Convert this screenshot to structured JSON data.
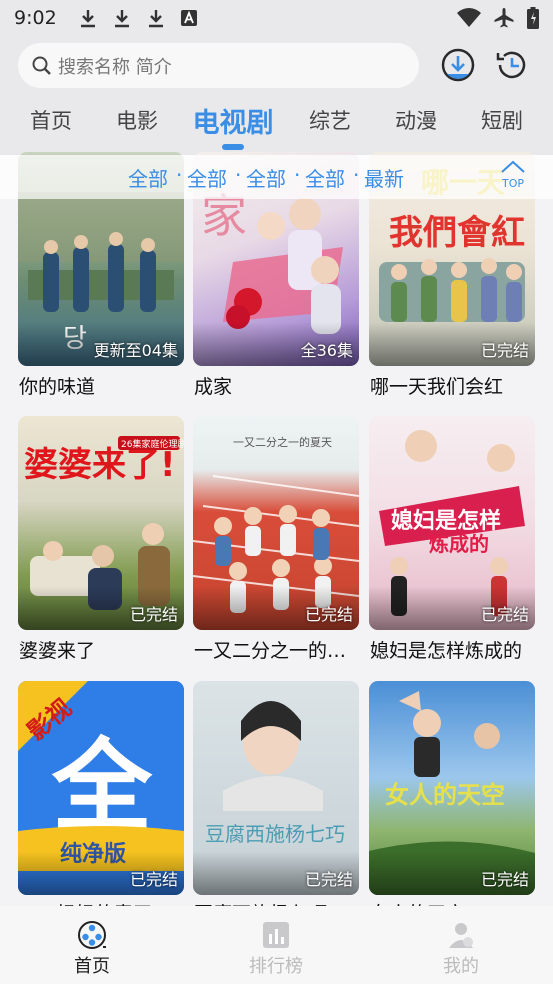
{
  "status_bar": {
    "time": "9:02"
  },
  "search": {
    "placeholder": "搜索名称 简介"
  },
  "tabs": [
    {
      "label": "首页"
    },
    {
      "label": "电影"
    },
    {
      "label": "电视剧"
    },
    {
      "label": "综艺"
    },
    {
      "label": "动漫"
    },
    {
      "label": "短剧"
    }
  ],
  "active_tab": "电视剧",
  "filters": [
    {
      "label": "全部"
    },
    {
      "label": "全部"
    },
    {
      "label": "全部"
    },
    {
      "label": "全部"
    },
    {
      "label": "最新"
    }
  ],
  "filter_separator": "·",
  "top_button": {
    "label": "TOP"
  },
  "items": [
    {
      "title": "你的味道",
      "badge": "更新至04集"
    },
    {
      "title": "成家",
      "badge": "全36集"
    },
    {
      "title": "哪一天我们会红",
      "badge": "已完结"
    },
    {
      "title": "婆婆来了",
      "badge": "已完结"
    },
    {
      "title": "一又二分之一的夏天",
      "badge": "已完结"
    },
    {
      "title": "媳妇是怎样炼成的",
      "badge": "已完结"
    },
    {
      "title": "丁丁妈妈的春天",
      "badge": "已完结"
    },
    {
      "title": "豆腐西施杨七巧",
      "badge": "已完结"
    },
    {
      "title": "女人的天空",
      "badge": "已完结"
    }
  ],
  "poster_text": {
    "p2": "家",
    "p2_sub": "全36集",
    "p3": "哪一天 我們會紅",
    "p4": "婆婆来了!",
    "p4_tag": "26集家庭伦理剧",
    "p5": "一又二分之一的夏天",
    "p6": "媳妇是怎样炼成的",
    "p7_top": "影视",
    "p7_main": "全",
    "p7_bottom": "纯净版",
    "p8": "豆腐西施杨七巧",
    "p9": "女人的天空"
  },
  "bottom_nav": [
    {
      "label": "首页"
    },
    {
      "label": "排行榜"
    },
    {
      "label": "我的"
    }
  ],
  "colors": {
    "accent": "#3a8ee6",
    "header_bg": "#e9e9ec",
    "page_bg": "#f3f3f5"
  }
}
